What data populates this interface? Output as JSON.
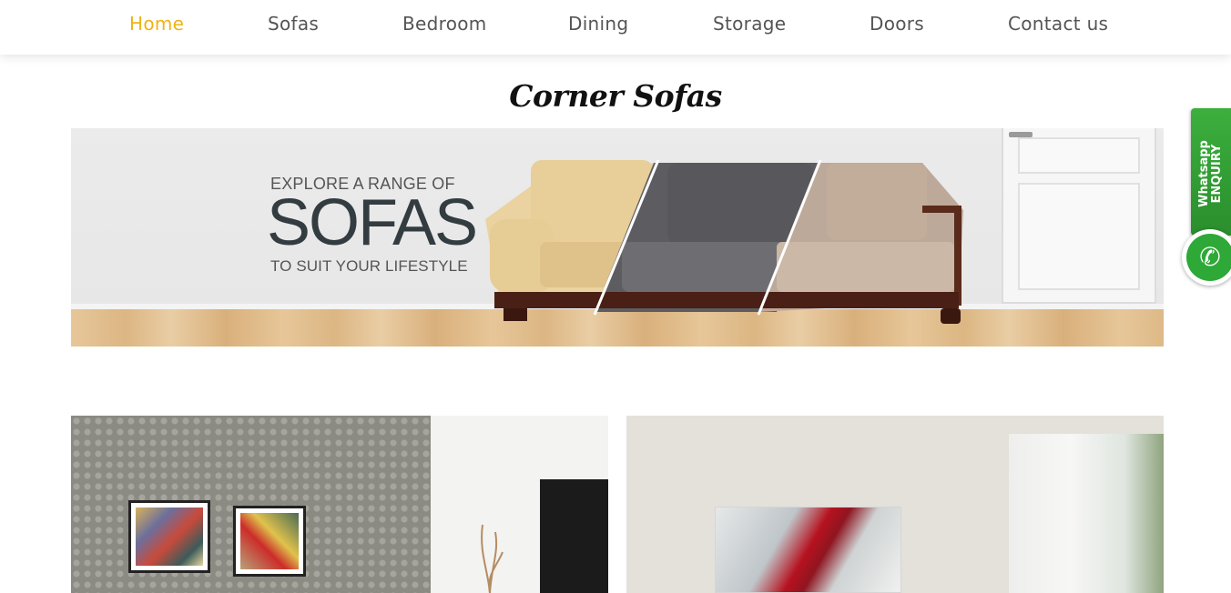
{
  "nav": {
    "items": [
      {
        "label": "Home",
        "active": true
      },
      {
        "label": "Sofas",
        "active": false
      },
      {
        "label": "Bedroom",
        "active": false
      },
      {
        "label": "Dining",
        "active": false
      },
      {
        "label": "Storage",
        "active": false
      },
      {
        "label": "Doors",
        "active": false
      },
      {
        "label": "Contact us",
        "active": false
      }
    ],
    "active_color": "#f0b315",
    "text_color": "#555555"
  },
  "page": {
    "title": "Corner Sofas"
  },
  "banner": {
    "line1": "EXPLORE A RANGE OF",
    "line2": "SOFAS",
    "line3": "TO SUIT YOUR LIFESTYLE"
  },
  "whatsapp": {
    "line1": "Whatsapp",
    "line2": "ENQUIRY",
    "icon": "whatsapp-phone-icon",
    "color": "#2ea836"
  }
}
